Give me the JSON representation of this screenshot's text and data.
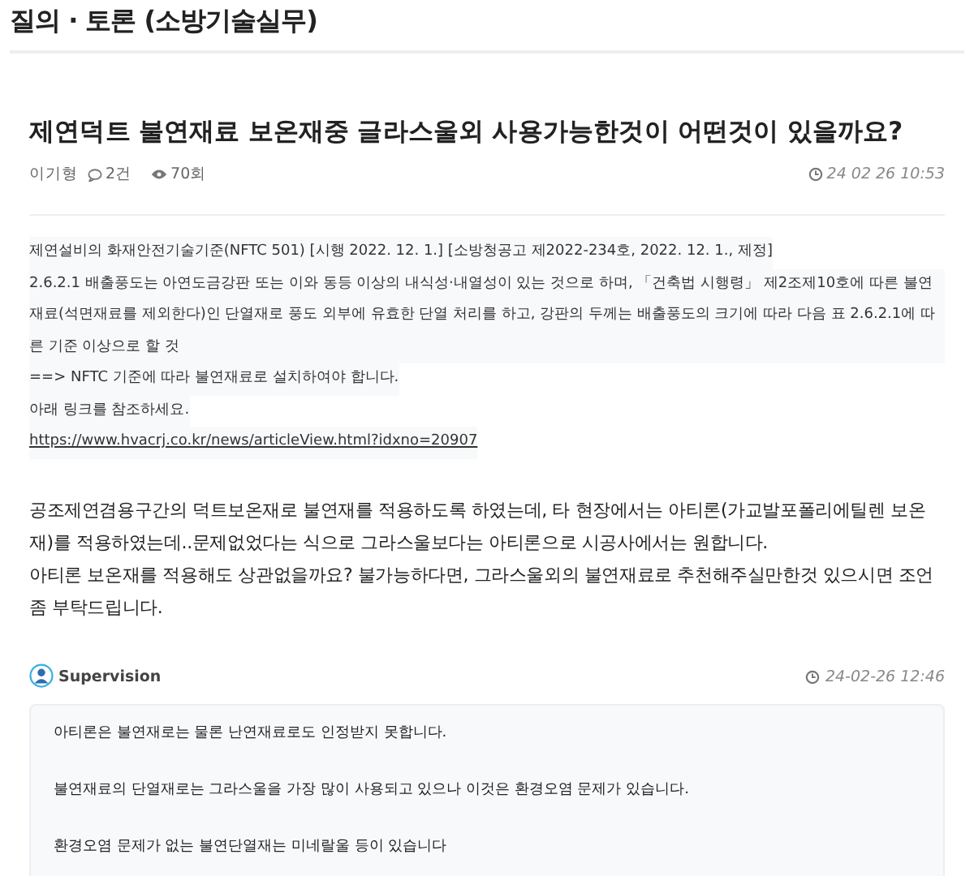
{
  "board_title": "질의 · 토론 (소방기술실무)",
  "post": {
    "title": "제연덕트 불연재료 보온재중 글라스울외 사용가능한것이 어떤것이 있을까요?",
    "author": "이기형",
    "comments": "2건",
    "views": "70회",
    "date": "24 02 26 10:53",
    "quote": [
      {
        "kind": "text",
        "text": "제연설비의 화재안전기술기준(NFTC 501) [시행 2022. 12. 1.] [소방청공고 제2022-234호, 2022. 12. 1., 제정]"
      },
      {
        "kind": "text",
        "text": "2.6.2.1 배출풍도는 아연도금강판 또는 이와 동등 이상의 내식성·내열성이 있는 것으로 하며, 「건축법 시행령」 제2조제10호에 따른 불연재료(석면재료를 제외한다)인 단열재로 풍도 외부에 유효한 단열 처리를 하고, 강판의 두께는 배출풍도의 크기에 따라 다음 표 2.6.2.1에 따른 기준 이상으로 할 것"
      },
      {
        "kind": "text",
        "text": "==> NFTC 기준에 따라 불연재료로 설치하여야 합니다."
      },
      {
        "kind": "text",
        "text": "아래 링크를 참조하세요."
      },
      {
        "kind": "link",
        "text": "https://www.hvacrj.co.kr/news/articleView.html?idxno=20907"
      }
    ],
    "body": [
      "공조제연겸용구간의 덕트보온재로 불연재를 적용하도록 하였는데, 타 현장에서는 아티론(가교발포폴리에틸렌 보온재)를 적용하였는데..문제없었다는 식으로 그라스울보다는 아티론으로 시공사에서는 원합니다.",
      "아티론 보온재를 적용해도 상관없을까요? 불가능하다면, 그라스울외의 불연재료로 추천해주실만한것 있으시면 조언 좀 부탁드립니다."
    ]
  },
  "reply": {
    "author": "Supervision",
    "date": "24-02-26 12:46",
    "lines": [
      "아티론은 불연재로는 물론 난연재료로도 인정받지 못합니다.",
      "불연재료의 단열재로는 그라스울을 가장 많이 사용되고 있으나 이것은 환경오염 문제가 있습니다.",
      "환경오염 문제가 없는 불연단열재는 미네랄울 등이 있습니다"
    ]
  }
}
